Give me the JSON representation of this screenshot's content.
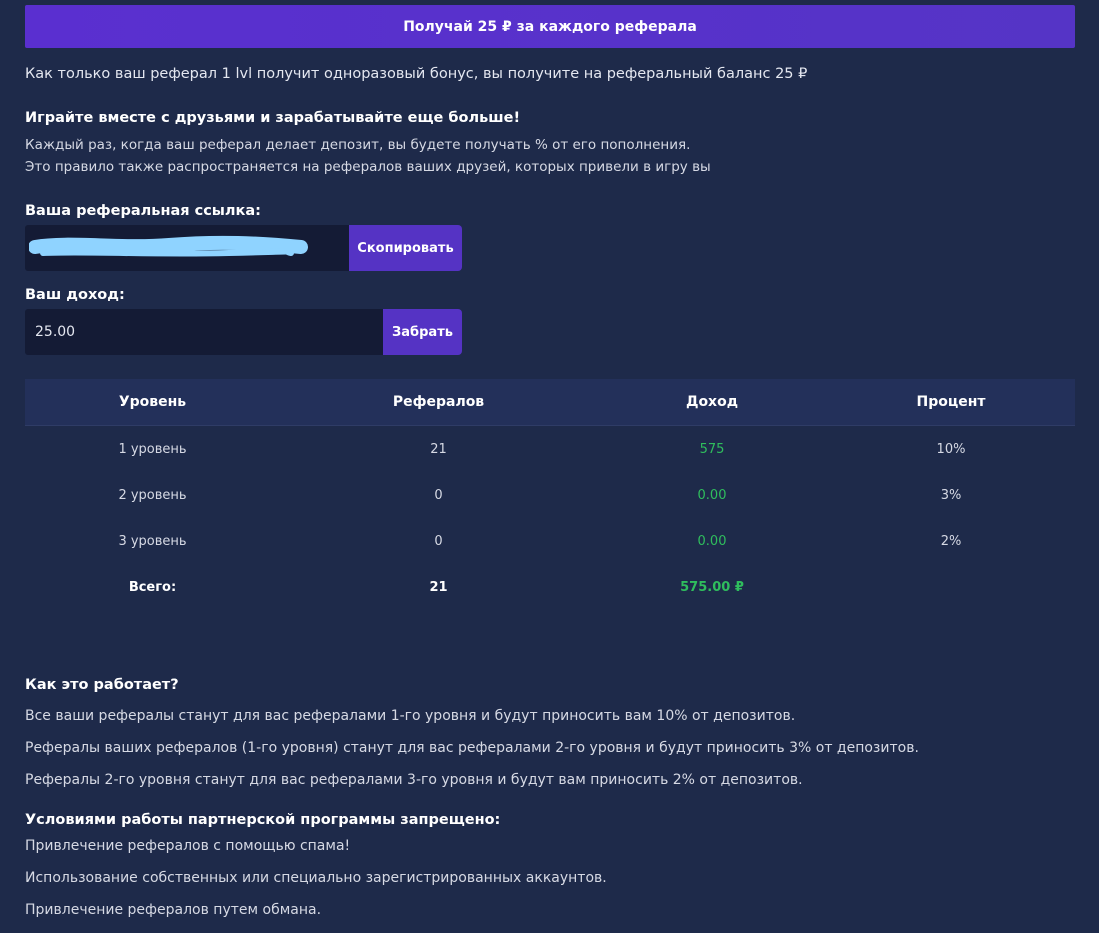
{
  "banner": {
    "label": "Получай 25 ₽ за каждого реферала"
  },
  "bonus_text": "Как только ваш реферал 1 lvl получит одноразовый бонус, вы получите на реферальный баланс 25 ₽",
  "play_section": {
    "title": "Играйте вместе с друзьями и зарабатывайте еще больше!",
    "lines": [
      "Каждый раз, когда ваш реферал делает депозит, вы будете получать % от его пополнения.",
      "Это правило также распространяется на рефералов ваших друзей, которых привели в игру вы"
    ]
  },
  "referral_link": {
    "label": "Ваша реферальная ссылка:",
    "copy_button": "Скопировать"
  },
  "income": {
    "label": "Ваш доход:",
    "value": "25.00",
    "claim_button": "Забрать"
  },
  "table": {
    "headers": [
      "Уровень",
      "Рефералов",
      "Доход",
      "Процент"
    ],
    "rows": [
      {
        "level": "1 уровень",
        "referrals": "21",
        "income": "575",
        "percent": "10%"
      },
      {
        "level": "2 уровень",
        "referrals": "0",
        "income": "0.00",
        "percent": "3%"
      },
      {
        "level": "3 уровень",
        "referrals": "0",
        "income": "0.00",
        "percent": "2%"
      }
    ],
    "total": {
      "label": "Всего:",
      "referrals": "21",
      "income": "575.00 ₽"
    }
  },
  "how_it_works": {
    "title": "Как это работает?",
    "lines": [
      "Все ваши рефералы станут для вас рефералами 1-го уровня и будут приносить вам 10% от депозитов.",
      "Рефералы ваших рефералов (1-го уровня) станут для вас рефералами 2-го уровня и будут приносить 3% от депозитов.",
      "Рефералы 2-го уровня станут для вас рефералами 3-го уровня и будут вам приносить 2% от депозитов."
    ]
  },
  "forbidden": {
    "title": "Условиями работы партнерской программы запрещено:",
    "lines": [
      "Привлечение рефералов с помощью спама!",
      "Использование собственных или специально зарегистрированных аккаунтов.",
      "Привлечение рефералов путем обмана."
    ]
  },
  "colors": {
    "background": "#1e2a4a",
    "accent": "#5533c4",
    "positive": "#2fbd5d",
    "redaction": "#8fd3ff"
  }
}
